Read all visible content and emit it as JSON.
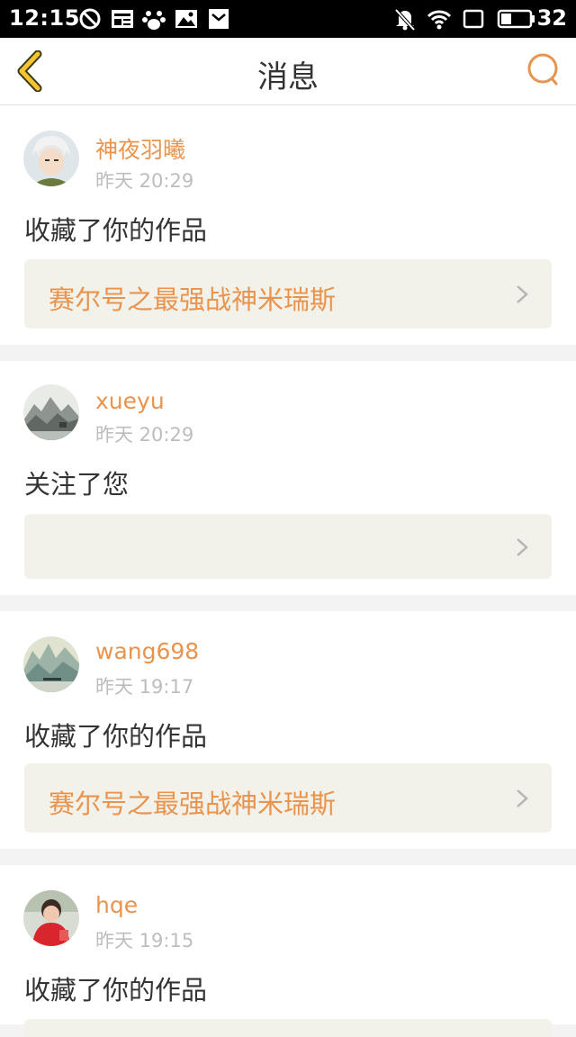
{
  "status_bar": {
    "time": "12:15",
    "battery": "32"
  },
  "nav": {
    "title": "消息"
  },
  "messages": [
    {
      "username": "神夜羽曦",
      "time": "昨天 20:29",
      "action": "收藏了你的作品",
      "work_title": "赛尔号之最强战神米瑞斯"
    },
    {
      "username": "xueyu",
      "time": "昨天 20:29",
      "action": "关注了您",
      "work_title": ""
    },
    {
      "username": "wang698",
      "time": "昨天 19:17",
      "action": "收藏了你的作品",
      "work_title": "赛尔号之最强战神米瑞斯"
    },
    {
      "username": "hqe",
      "time": "昨天 19:15",
      "action": "收藏了你的作品",
      "work_title": ""
    }
  ],
  "colors": {
    "accent": "#e8944e",
    "back_arrow": "#f4c52e",
    "card_bg": "#f3f2ea"
  }
}
